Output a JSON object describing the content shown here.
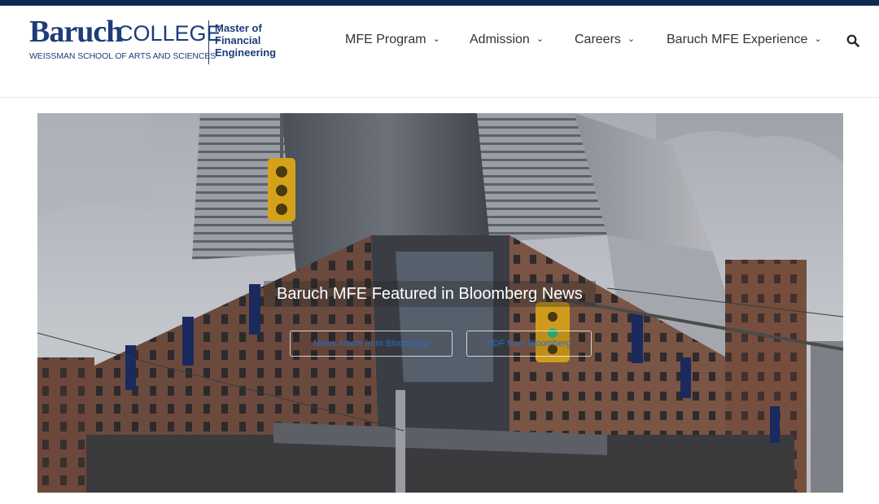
{
  "logo": {
    "baruch": "Baruch",
    "college": "COLLEGE",
    "school": "WEISSMAN SCHOOL OF ARTS AND SCIENCES",
    "mfe_line1": "Master of",
    "mfe_line2": "Financial",
    "mfe_line3": "Engineering"
  },
  "nav": {
    "items": [
      {
        "label": "MFE Program"
      },
      {
        "label": "Admission"
      },
      {
        "label": "Careers"
      },
      {
        "label": "Baruch MFE Experience"
      }
    ],
    "chevron": "chevron-down-icon",
    "search_icon": "search-icon"
  },
  "hero": {
    "title": "Baruch MFE Featured in Bloomberg News",
    "buttons": [
      {
        "label": "News Article from Bloomberg"
      },
      {
        "label": "PDF from Bloomberg"
      }
    ]
  },
  "colors": {
    "brand_navy": "#1d3c7a",
    "top_bar": "#0d2a52",
    "button_text": "#2a6cc4"
  }
}
